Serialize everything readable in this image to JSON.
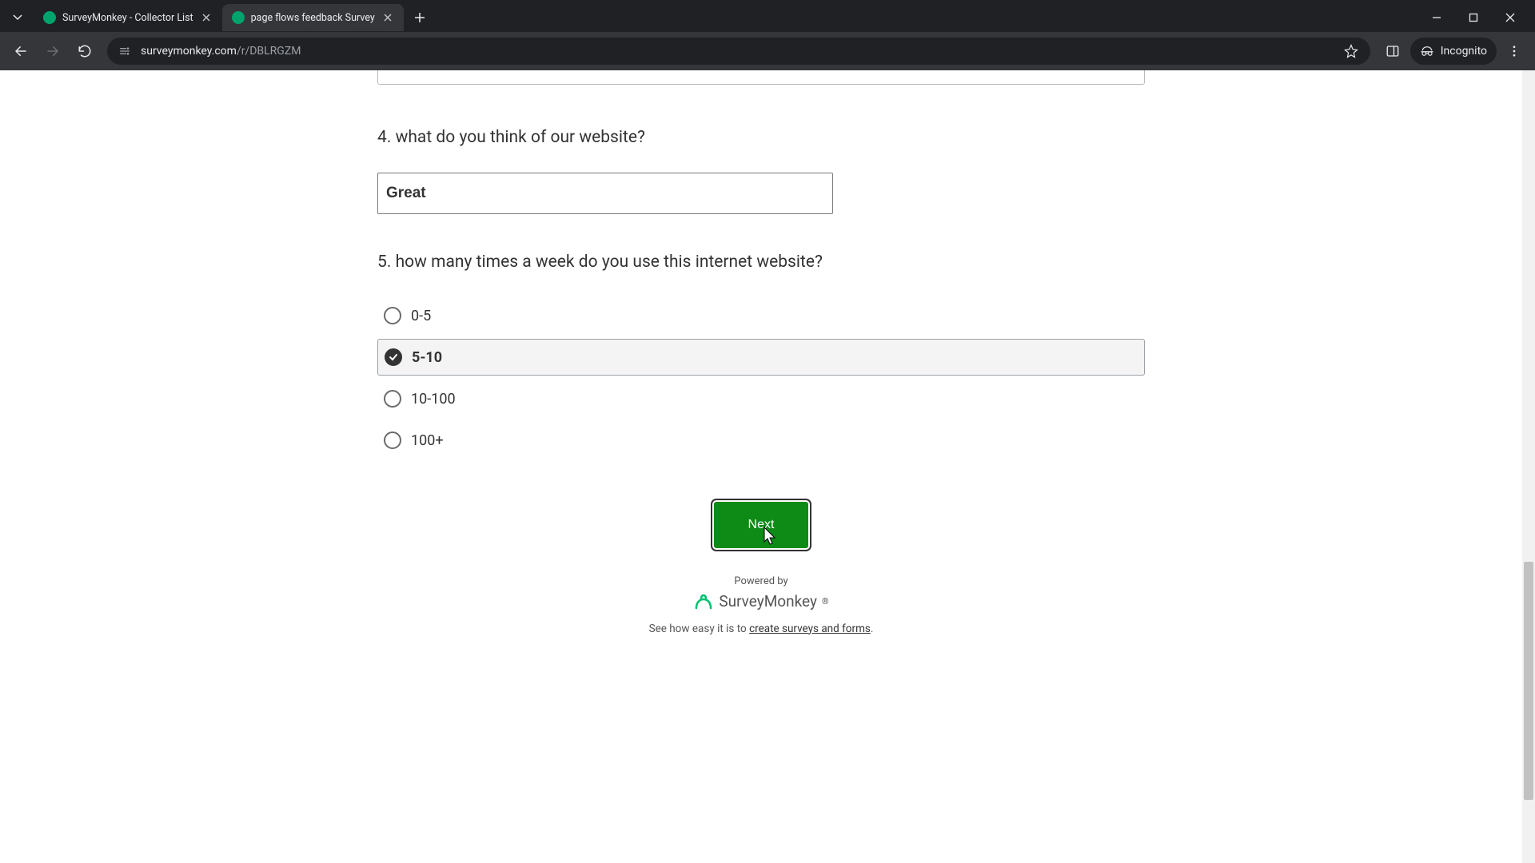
{
  "browser": {
    "tabs": [
      {
        "title": "SurveyMonkey - Collector List",
        "active": false
      },
      {
        "title": "page flows feedback Survey",
        "active": true
      }
    ],
    "url_domain": "surveymonkey.com",
    "url_path": "/r/DBLRGZM",
    "incognito_label": "Incognito"
  },
  "survey": {
    "q4": {
      "number": "4",
      "text": "what do you think of our website?",
      "value": "Great"
    },
    "q5": {
      "number": "5",
      "text": "how many times a week do you use this internet website?",
      "options": [
        "0-5",
        "5-10",
        "10-100",
        "100+"
      ],
      "selected_index": 1
    },
    "next_label": "Next"
  },
  "footer": {
    "powered_by": "Powered by",
    "brand": "SurveyMonkey",
    "tagline_prefix": "See how easy it is to ",
    "tagline_link": "create surveys and forms",
    "tagline_suffix": "."
  }
}
